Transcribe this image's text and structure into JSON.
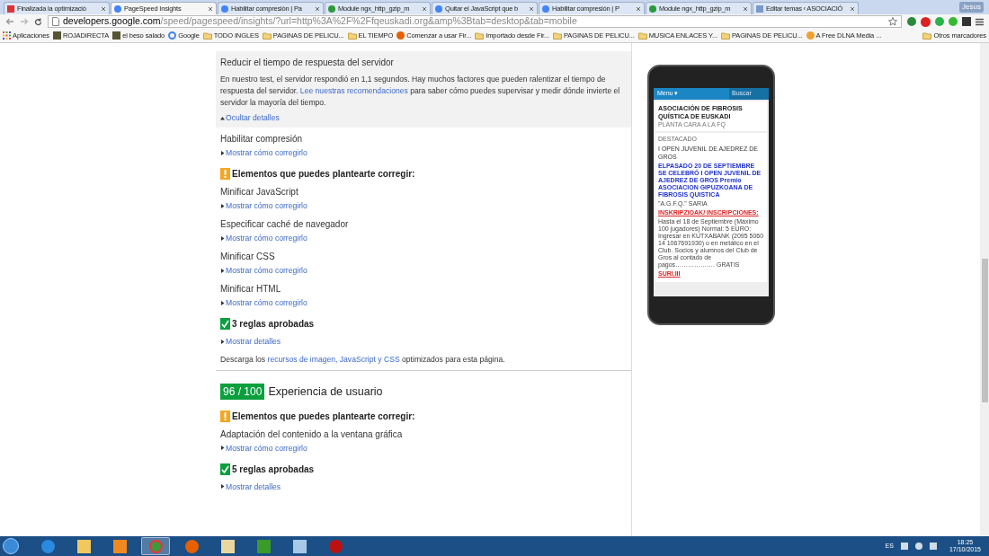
{
  "tabs": [
    {
      "title": "Finalizada la optimizació",
      "selected": false
    },
    {
      "title": "PageSpeed Insights",
      "selected": true
    },
    {
      "title": "Habilitar compresión | Pa",
      "selected": false
    },
    {
      "title": "Module ngx_http_gzip_m",
      "selected": false
    },
    {
      "title": "Quitar el JavaScript que b",
      "selected": false
    },
    {
      "title": "Habilitar compresión | P",
      "selected": false
    },
    {
      "title": "Module ngx_http_gzip_m",
      "selected": false
    },
    {
      "title": "Editar temas ‹ ASOCIACIÓ",
      "selected": false
    }
  ],
  "user": "Jesus",
  "address": {
    "host": "developers.google.com",
    "path": "/speed/pagespeed/insights/?url=http%3A%2F%2Ffqeuskadi.org&amp%3Btab=desktop&tab=mobile"
  },
  "bookmarks": [
    "Aplicaciones",
    "ROJADIRECTA",
    "el beso salado",
    "Google",
    "TODO INGLES",
    "PAGINAS DE PELICU...",
    "EL TIEMPO",
    "Comenzar a usar Fir...",
    "Importado desde Fir...",
    "PAGINAS DE PELICU...",
    "MUSICA ENLACES Y...",
    "PAGINAS DE PELICU...",
    "A Free DLNA Media ..."
  ],
  "other_bookmarks": "Otros marcadores",
  "expanded_rule": {
    "title": "Reducir el tiempo de respuesta del servidor",
    "before": "En nuestro test, el servidor respondió en 1,1 segundos. Hay muchos factores que pueden ralentizar el tiempo de respuesta del servidor. ",
    "link": "Lee nuestras recomendaciones",
    "after": " para saber cómo puedes supervisar y medir dónde invierte el servidor la mayoría del tiempo.",
    "toggle": "Ocultar detalles"
  },
  "sections": [
    {
      "kind": "rule",
      "title": "Habilitar compresión",
      "link": "Mostrar cómo corregirlo"
    },
    {
      "kind": "warning",
      "title": "Elementos que puedes plantearte corregir:"
    },
    {
      "kind": "rule",
      "title": "Minificar JavaScript",
      "link": "Mostrar cómo corregirlo"
    },
    {
      "kind": "rule",
      "title": "Especificar caché de navegador",
      "link": "Mostrar cómo corregirlo"
    },
    {
      "kind": "rule",
      "title": "Minificar CSS",
      "link": "Mostrar cómo corregirlo"
    },
    {
      "kind": "rule",
      "title": "Minificar HTML",
      "link": "Mostrar cómo corregirlo"
    },
    {
      "kind": "pass",
      "title": "3 reglas aprobadas"
    },
    {
      "kind": "rule",
      "link": "Mostrar detalles"
    },
    {
      "kind": "note",
      "before": "Descarga los ",
      "link": "recursos de imagen, JavaScript y CSS",
      "after": " optimizados para esta página."
    },
    {
      "kind": "score",
      "score": "96 / 100",
      "title": "Experiencia de usuario"
    },
    {
      "kind": "warning",
      "title": "Elementos que puedes plantearte corregir:"
    },
    {
      "kind": "rule",
      "title": "Adaptación del contenido a la ventana gráfica",
      "link": "Mostrar cómo corregirlo"
    },
    {
      "kind": "pass",
      "title": "5 reglas aprobadas"
    },
    {
      "kind": "rule",
      "link": "Mostrar detalles"
    }
  ],
  "phone": {
    "menu": "Menu ▾",
    "search": "Buscar",
    "site_title": "ASOCIACIÓN DE FIBROSIS QUÍSTICA DE EUSKADI",
    "tagline": "PLANTA CARA A LA FQ",
    "category": "DESTACADO",
    "post_title": "I OPEN JUVENIL DE AJEDREZ DE GROS",
    "lines": [
      {
        "kind": "blue",
        "text": "ELPASADO 20 DE SEPTIEMBRE SE CELEBRÓ I OPEN JUVENIL DE AJEDREZ DE GROS Premio ASOCIACION GIPUZKOANA DE FIBROSIS QUISTICA"
      },
      {
        "kind": "plain",
        "text": "\"A.G.F.Q.\" SARIA"
      },
      {
        "kind": "red",
        "text": "INSKRIPZIOAK/ INSCRIPCIONES:"
      },
      {
        "kind": "plain",
        "text": "Hasta el 18 de Septiembre (Máximo 100 jugadores) Normal: 5 EURO: Ingresar en KUTXABANK (2095 5060 14 1067691930) o en metálico en el Club. Socios y alumnos del Club de Gros al contado de pagos………………. GRATIS"
      },
      {
        "kind": "red",
        "text": "SURI.III"
      }
    ]
  },
  "tray": {
    "lang": "ES",
    "time": "18:25",
    "date": "17/10/2015"
  },
  "taskbar": [
    {
      "selected": false
    },
    {
      "selected": false
    },
    {
      "selected": false
    },
    {
      "selected": true
    },
    {
      "selected": false
    },
    {
      "selected": false
    },
    {
      "selected": false
    },
    {
      "selected": false
    },
    {
      "selected": false
    }
  ]
}
